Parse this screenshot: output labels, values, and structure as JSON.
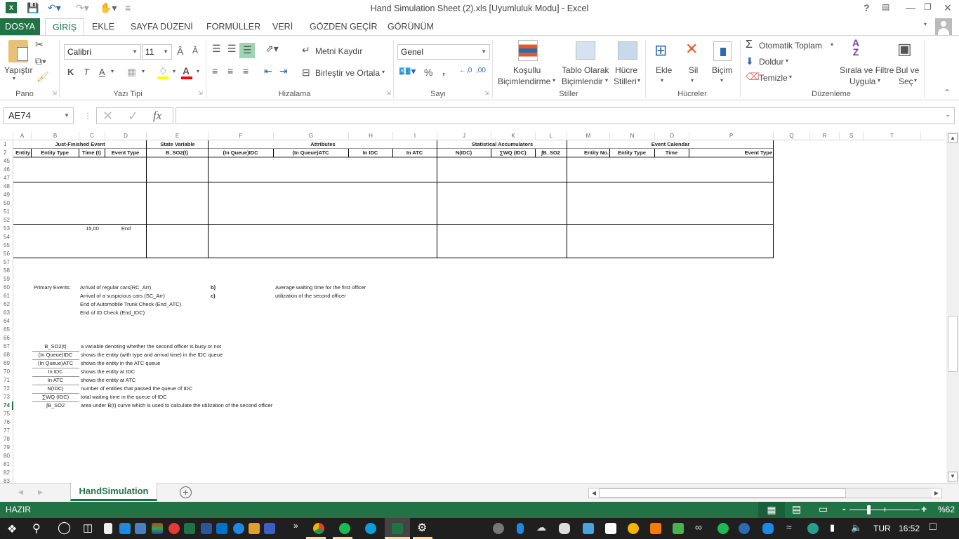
{
  "window": {
    "title": "Hand Simulation Sheet (2).xls  [Uyumluluk Modu] - Excel",
    "help": "?",
    "controls": [
      "ribbon-display",
      "minimize",
      "restore",
      "close"
    ]
  },
  "ribbon_tabs": [
    "DOSYA",
    "GİRİŞ",
    "EKLE",
    "SAYFA DÜZENİ",
    "FORMÜLLER",
    "VERİ",
    "GÖZDEN GEÇİR",
    "GÖRÜNÜM"
  ],
  "ribbon": {
    "pano": {
      "label": "Pano",
      "paste": "Yapıştır"
    },
    "font": {
      "label": "Yazı Tipi",
      "name": "Calibri",
      "size": "11",
      "bold": "K",
      "italic": "T",
      "underline": "A",
      "fill_color": "#ffff00",
      "font_color": "#ff0000"
    },
    "align": {
      "label": "Hizalama",
      "wrap": "Metni Kaydır",
      "merge": "Birleştir ve Ortala"
    },
    "number": {
      "label": "Sayı",
      "format": "Genel",
      "percent": "%",
      "comma": ","
    },
    "styles": {
      "label": "Stiller",
      "cond1": "Koşullu",
      "cond2": "Biçimlendirme",
      "table1": "Tablo Olarak",
      "table2": "Biçimlendir",
      "cell1": "Hücre",
      "cell2": "Stilleri"
    },
    "cells": {
      "label": "Hücreler",
      "insert": "Ekle",
      "delete": "Sil",
      "format": "Biçim"
    },
    "editing": {
      "label": "Düzenleme",
      "autosum": "Otomatik Toplam",
      "fill": "Doldur",
      "clear": "Temizle",
      "sort1": "Sırala ve Filtre",
      "sort2": "Uygula",
      "find1": "Bul ve",
      "find2": "Seç"
    }
  },
  "formula_bar": {
    "name_box": "AE74",
    "fx": "fx",
    "value": ""
  },
  "columns": [
    "A",
    "B",
    "C",
    "D",
    "E",
    "F",
    "G",
    "H",
    "I",
    "J",
    "K",
    "L",
    "M",
    "N",
    "O",
    "P",
    "Q",
    "R",
    "S",
    "T"
  ],
  "rows": [
    "1",
    "2",
    "45",
    "46",
    "47",
    "48",
    "49",
    "50",
    "51",
    "52",
    "53",
    "54",
    "55",
    "56",
    "57",
    "58",
    "59",
    "60",
    "61",
    "62",
    "63",
    "64",
    "65",
    "66",
    "67",
    "68",
    "69",
    "70",
    "71",
    "72",
    "73",
    "74",
    "75",
    "76",
    "77",
    "78",
    "79",
    "80",
    "81",
    "82",
    "83"
  ],
  "selected_row": "74",
  "table_headers": {
    "groups": [
      "Just-Finished Event",
      "State Variable",
      "Attributes",
      "Statistical Accumulators",
      "Event Calendar"
    ],
    "columns": [
      "Entity",
      "Entity Type",
      "Time (t)",
      "Event Type",
      "B_SO2(t)",
      "(In Queue)IDC",
      "(In Queue)ATC",
      "In IDC",
      "In ATC",
      "N(IDC)",
      "∑WQ (IDC)",
      "∫B_SO2",
      "Entity No.",
      "Entity Type",
      "Time",
      "Event Type"
    ]
  },
  "row53": {
    "time": "15,00",
    "event_type": "End"
  },
  "primary_events": {
    "label": "Primary Events:",
    "items": [
      "Arrival of regular cars(RC_Arr)",
      "Arrival of a suspicious cars (SC_Arr)",
      "End of Automobile Trunk Check (End_ATC)",
      "End of ID Check (End_IDC)"
    ]
  },
  "questions": [
    {
      "key": "b)",
      "text": "Average waiting time for the first officer"
    },
    {
      "key": "c)",
      "text": "utilization of the second officer"
    }
  ],
  "legend": [
    {
      "term": "B_SO2(t)",
      "desc": "a variable denoting whether the second officer is busy or not"
    },
    {
      "term": "(In Queue)IDC",
      "desc": "shows the entity (with type and arrival time) in the IDC queue"
    },
    {
      "term": "(In Queue)ATC",
      "desc": "shows the entity in the ATC queue"
    },
    {
      "term": "In IDC",
      "desc": "shows the entity  at IDC"
    },
    {
      "term": "In ATC",
      "desc": "shows the entity  at ATC"
    },
    {
      "term": "N(IDC)",
      "desc": "number of entities that passed the queue of IDC"
    },
    {
      "term": "∑WQ (IDC)",
      "desc": "total waiting time in the queue of IDC"
    },
    {
      "term": "∫B_SO2",
      "desc": "area under B(t) curve which is used to calculate the utilization of the second officer"
    }
  ],
  "sheet_tabs": [
    "HandSimulation"
  ],
  "status": {
    "ready": "HAZIR",
    "zoom": "%62",
    "zoom_fraction": 0.62
  },
  "taskbar": {
    "lang": "TUR",
    "time": "16:52",
    "chevron": "»"
  },
  "colors": {
    "accent": "#217346",
    "taskbar": "#1f1f1f"
  }
}
